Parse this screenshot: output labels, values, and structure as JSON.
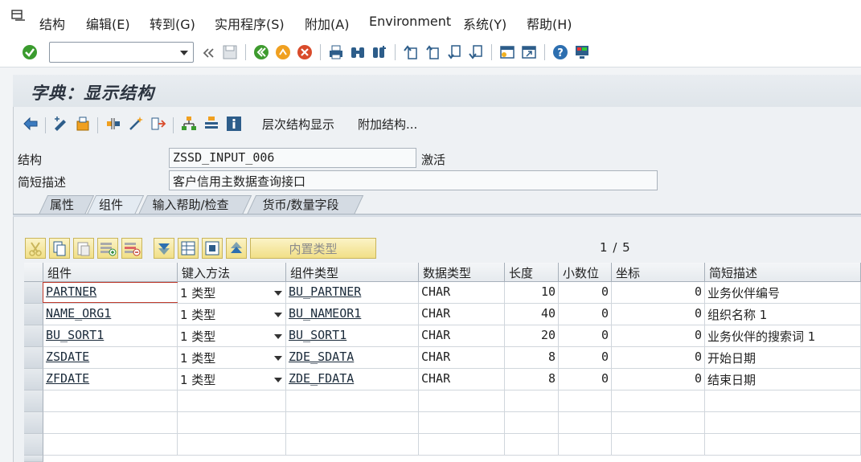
{
  "menu": [
    "结构",
    "编辑(E)",
    "转到(G)",
    "实用程序(S)",
    "附加(A)",
    "Environment",
    "系统(Y)",
    "帮助(H)"
  ],
  "command_field": {
    "value": ""
  },
  "title": "字典：显示结构",
  "app_toolbar": {
    "hierarchy_label": "层次结构显示",
    "append_label": "附加结构..."
  },
  "header": {
    "structure_label": "结构",
    "structure_value": "ZSSD_INPUT_006",
    "status": "激活",
    "desc_label": "简短描述",
    "desc_value": "客户信用主数据查询接口"
  },
  "tabs": [
    "属性",
    "组件",
    "输入帮助/检查",
    "货币/数量字段"
  ],
  "active_tab": "组件",
  "table_toolbar": {
    "builtin_label": "内置类型"
  },
  "pager": {
    "current": "1",
    "sep": "/",
    "total": "5"
  },
  "table": {
    "columns": [
      "组件",
      "键入方法",
      "组件类型",
      "数据类型",
      "长度",
      "小数位",
      "坐标",
      "简短描述"
    ],
    "rows": [
      {
        "component": "PARTNER",
        "method": "1 类型",
        "ctype": "BU_PARTNER",
        "dtype": "CHAR",
        "length": "10",
        "decimals": "0",
        "coord": "0",
        "desc": "业务伙伴编号"
      },
      {
        "component": "NAME_ORG1",
        "method": "1 类型",
        "ctype": "BU_NAMEOR1",
        "dtype": "CHAR",
        "length": "40",
        "decimals": "0",
        "coord": "0",
        "desc": "组织名称 1"
      },
      {
        "component": "BU_SORT1",
        "method": "1 类型",
        "ctype": "BU_SORT1",
        "dtype": "CHAR",
        "length": "20",
        "decimals": "0",
        "coord": "0",
        "desc": "业务伙伴的搜索词 1"
      },
      {
        "component": "ZSDATE",
        "method": "1 类型",
        "ctype": "ZDE_SDATA",
        "dtype": "CHAR",
        "length": "8",
        "decimals": "0",
        "coord": "0",
        "desc": "开始日期"
      },
      {
        "component": "ZFDATE",
        "method": "1 类型",
        "ctype": "ZDE_FDATA",
        "dtype": "CHAR",
        "length": "8",
        "decimals": "0",
        "coord": "0",
        "desc": "结束日期"
      }
    ]
  },
  "colors": {
    "background": "#f2f4f6",
    "title_band": "#e3e8ed",
    "button_yellow": "#f4e59a",
    "ok_green": "#3a9b2e"
  }
}
